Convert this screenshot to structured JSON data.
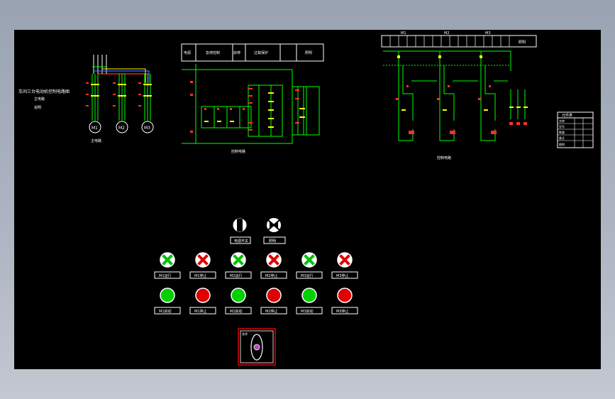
{
  "title_block": {
    "line1": "车间三台电动机控制电路图",
    "line2": "主电路",
    "line3": "说明"
  },
  "motors": [
    "M1",
    "M2",
    "M3"
  ],
  "main_circuit_label": "主电路",
  "control_a_label": "控制电路",
  "control_b_label": "控制电路",
  "header_a_cells": [
    "电源",
    "急停控制",
    "启停",
    "过载保护",
    "照明"
  ],
  "header_b_groups": [
    "M1",
    "M2",
    "M3",
    "照明"
  ],
  "legend_table": {
    "header": "元件表",
    "rows": [
      "名称",
      "型号",
      "数量",
      "备注",
      "图例"
    ]
  },
  "knob_labels": [
    "电源开关",
    "照明"
  ],
  "indicator_labels": [
    "M1运行",
    "M1停止",
    "M2运行",
    "M2停止",
    "M3运行",
    "M3停止"
  ],
  "button_labels": [
    "M1启动",
    "M1停止",
    "M2启动",
    "M2停止",
    "M3启动",
    "M3停止"
  ],
  "estop_label": "急停",
  "colors": {
    "background": "#000000",
    "wire": "#00ff00",
    "text": "#ffffff",
    "accent": "#ff0000",
    "blue": "#4a6bff",
    "yellow": "#ffff00",
    "frame_outer": "#9aa3b2"
  }
}
